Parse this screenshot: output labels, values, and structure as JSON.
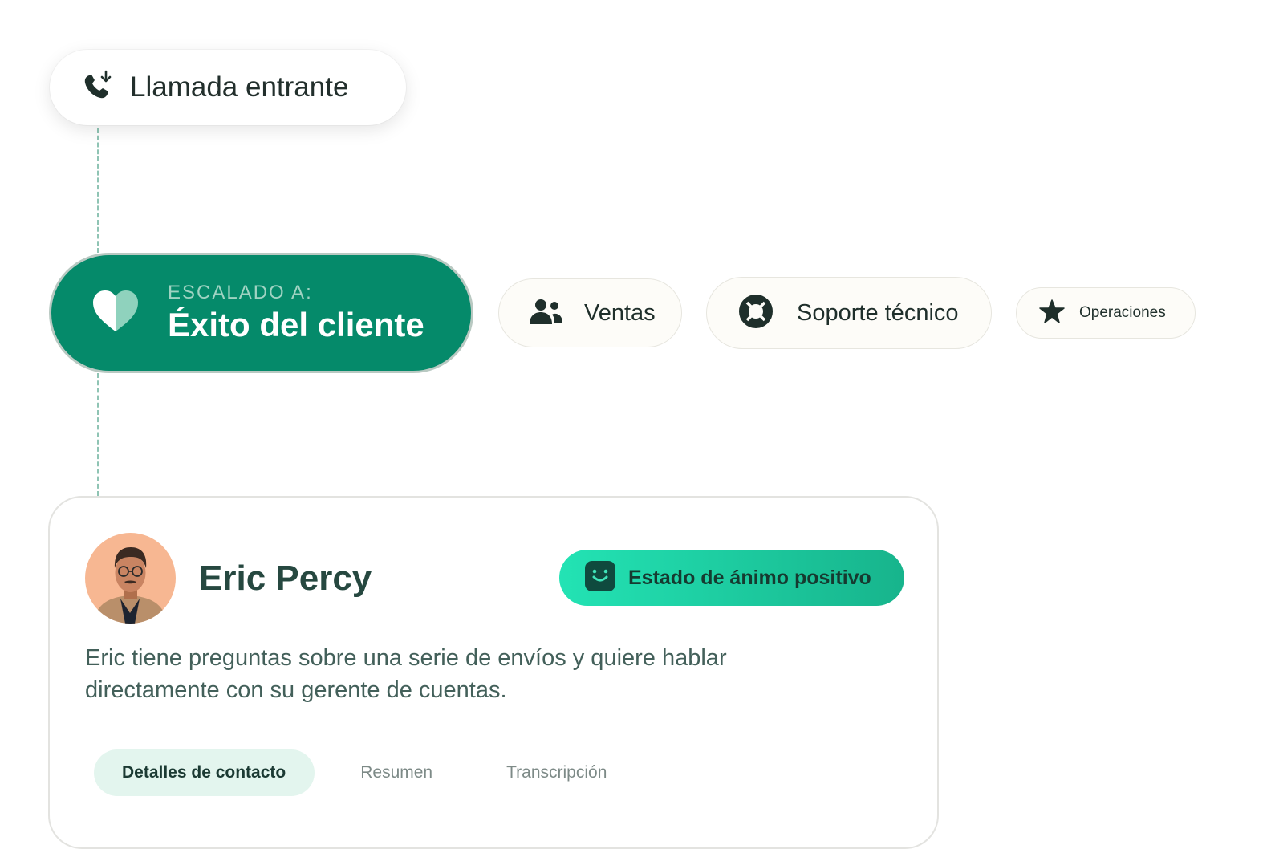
{
  "incoming": {
    "label": "Llamada entrante",
    "icon": "incoming-call-icon"
  },
  "escalation": {
    "prefix": "ESCALADO A:",
    "destination": "Éxito del cliente",
    "icon": "heart-icon"
  },
  "options": [
    {
      "label": "Ventas",
      "icon": "people-icon"
    },
    {
      "label": "Soporte técnico",
      "icon": "lifebuoy-icon"
    },
    {
      "label": "Operaciones",
      "icon": "star-icon"
    }
  ],
  "contact": {
    "name": "Eric Percy",
    "mood": "Estado de ánimo positivo",
    "description": "Eric tiene preguntas sobre una serie de envíos y quiere hablar directamente con su gerente de cuentas.",
    "tabs": [
      {
        "label": "Detalles de contacto",
        "active": true
      },
      {
        "label": "Resumen",
        "active": false
      },
      {
        "label": "Transcripción",
        "active": false
      }
    ]
  },
  "colors": {
    "accent": "#058a6a",
    "mood_gradient_start": "#23e3b4",
    "mood_gradient_end": "#17b48c",
    "connector": "#8fc4b4"
  }
}
